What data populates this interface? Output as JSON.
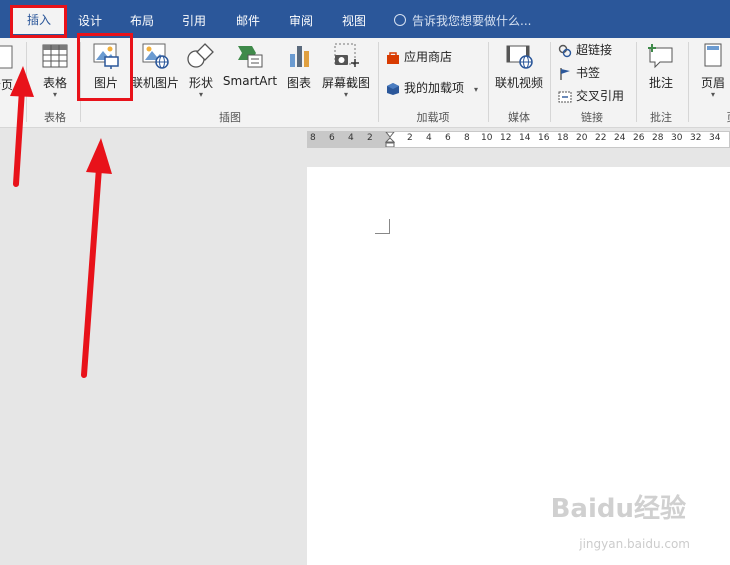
{
  "tabs": [
    "插入",
    "设计",
    "布局",
    "引用",
    "邮件",
    "审阅",
    "视图"
  ],
  "tellme": "告诉我您想要做什么...",
  "ribbon": {
    "page_partial": "分页",
    "table": "表格",
    "picture": "图片",
    "online_picture": "联机图片",
    "shapes": "形状",
    "smartart": "SmartArt",
    "chart": "图表",
    "screenshot": "屏幕截图",
    "store": "应用商店",
    "my_addins": "我的加载项",
    "online_video": "联机视频",
    "hyperlink": "超链接",
    "bookmark": "书签",
    "crossref": "交叉引用",
    "comment": "批注",
    "header": "页眉",
    "groups": {
      "tables": "表格",
      "illustrations": "插图",
      "addins": "加载项",
      "media": "媒体",
      "links": "链接",
      "comments": "批注",
      "hf_partial": "页"
    }
  },
  "ruler": [
    "8",
    "6",
    "4",
    "2",
    "2",
    "4",
    "6",
    "8",
    "10",
    "12",
    "14",
    "16",
    "18",
    "20",
    "22",
    "24",
    "26",
    "28",
    "30",
    "32",
    "34"
  ],
  "watermark": {
    "logo": "Baidu经验",
    "url": "jingyan.baidu.com"
  },
  "colors": {
    "accent": "#2b579a",
    "highlight": "#e8121a"
  }
}
